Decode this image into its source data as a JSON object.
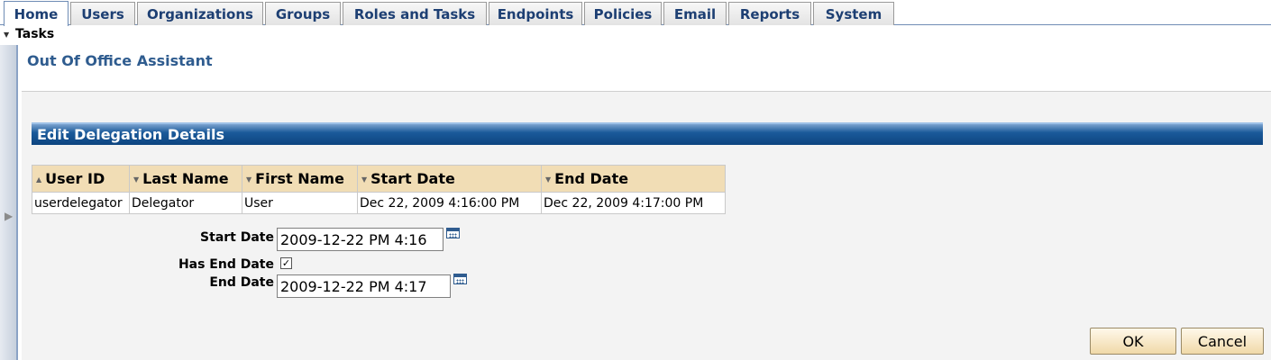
{
  "tabs": [
    "Home",
    "Users",
    "Organizations",
    "Groups",
    "Roles and Tasks",
    "Endpoints",
    "Policies",
    "Email",
    "Reports",
    "System"
  ],
  "tasks_label": "Tasks",
  "page_title": "Out Of Office Assistant",
  "section_title": "Edit Delegation Details",
  "table": {
    "columns": [
      "User ID",
      "Last Name",
      "First Name",
      "Start Date",
      "End Date"
    ],
    "rows": [
      [
        "userdelegator",
        "Delegator",
        "User",
        "Dec 22, 2009 4:16:00 PM",
        "Dec 22, 2009 4:17:00 PM"
      ]
    ]
  },
  "form": {
    "start_date_label": "Start Date",
    "start_date_value": "2009-12-22 PM 4:16",
    "has_end_date_label": "Has End Date",
    "has_end_date_checked": true,
    "end_date_label": "End Date",
    "end_date_value": "2009-12-22 PM 4:17"
  },
  "buttons": {
    "ok": "OK",
    "cancel": "Cancel"
  }
}
